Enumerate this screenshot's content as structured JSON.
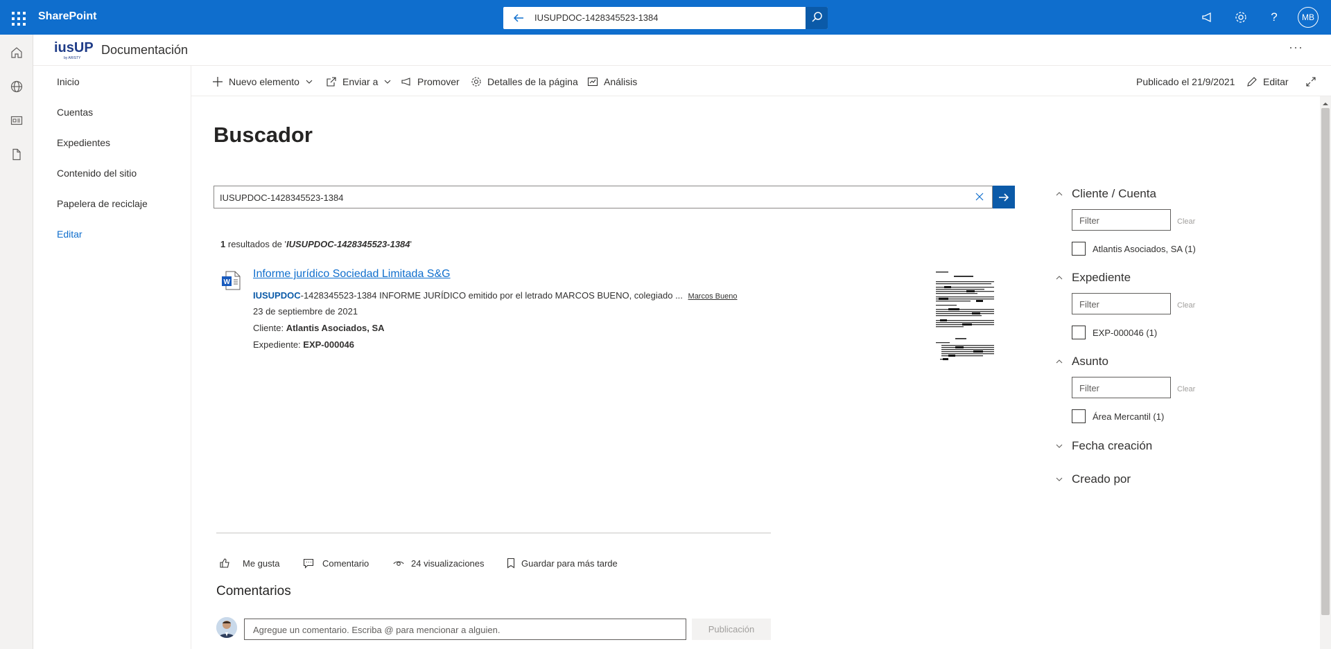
{
  "suitebar": {
    "brand": "SharePoint",
    "search_value": "IUSUPDOC-1428345523-1384",
    "avatar_initials": "MB",
    "icons": [
      "waffle-icon",
      "back-arrow-icon",
      "search-icon",
      "megaphone-icon",
      "gear-icon",
      "help-icon"
    ]
  },
  "appbar": {
    "icons": [
      "home-icon",
      "globe-icon",
      "news-icon",
      "document-icon"
    ]
  },
  "site": {
    "logo_text": "iusUP",
    "logo_subtext": "by ARISTY",
    "title": "Documentación",
    "more": "···"
  },
  "nav": {
    "items": [
      "Inicio",
      "Cuentas",
      "Expedientes",
      "Contenido del sitio",
      "Papelera de reciclaje"
    ],
    "edit": "Editar"
  },
  "commands": {
    "new_item": "Nuevo elemento",
    "send_to": "Enviar a",
    "promote": "Promover",
    "page_details": "Detalles de la página",
    "analytics": "Análisis",
    "published": "Publicado el 21/9/2021",
    "edit": "Editar"
  },
  "main": {
    "title": "Buscador",
    "search_value": "IUSUPDOC-1428345523-1384",
    "results_count": "1",
    "results_text": "resultados de '",
    "results_query": "IUSUPDOC-1428345523-1384",
    "results_end": "'"
  },
  "result": {
    "title": "Informe jurídico Sociedad Limitada S&G",
    "snippet_highlight": "IUSUPDOC",
    "snippet_rest": "-1428345523-1384 INFORME JURÍDICO emitido por el letrado MARCOS BUENO, colegiado ...",
    "author": "Marcos Bueno",
    "date": "23 de septiembre de 2021",
    "client_label": "Cliente:",
    "client_value": "Atlantis Asociados, SA",
    "file_label": "Expediente:",
    "file_value": "EXP-000046"
  },
  "social": {
    "like": "Me gusta",
    "comment": "Comentario",
    "views": "24 visualizaciones",
    "save": "Guardar para más tarde"
  },
  "comments": {
    "title": "Comentarios",
    "placeholder": "Agregue un comentario. Escriba @ para mencionar a alguien.",
    "post": "Publicación"
  },
  "refiners": [
    {
      "title": "Cliente / Cuenta",
      "expanded": true,
      "filter_placeholder": "Filter",
      "clear": "Clear",
      "option": "Atlantis Asociados, SA (1)"
    },
    {
      "title": "Expediente",
      "expanded": true,
      "filter_placeholder": "Filter",
      "clear": "Clear",
      "option": "EXP-000046 (1)"
    },
    {
      "title": "Asunto",
      "expanded": true,
      "filter_placeholder": "Filter",
      "clear": "Clear",
      "option": "Área Mercantil (1)"
    },
    {
      "title": "Fecha creación",
      "expanded": false
    },
    {
      "title": "Creado por",
      "expanded": false
    }
  ],
  "colors": {
    "brand": "#0f6ecd",
    "brand_dark": "#0b5aa8"
  }
}
